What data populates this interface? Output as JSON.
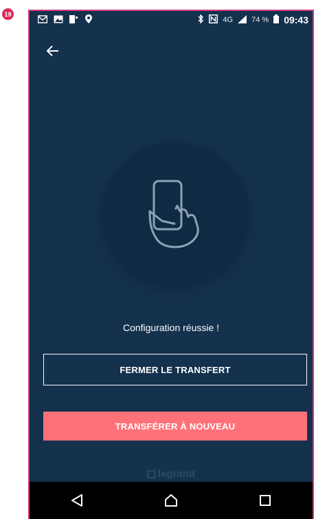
{
  "step_badge": "19",
  "status_bar": {
    "left_icons": [
      "mail-icon",
      "image-icon",
      "notification-icon",
      "location-icon"
    ],
    "right_icons": [
      "bluetooth-icon",
      "nfc-icon",
      "signal-icon"
    ],
    "network": "4G",
    "battery": "74 %",
    "time": "09:43"
  },
  "header": {
    "back_icon": "arrow-left-icon"
  },
  "hero": {
    "icon": "hand-holding-phone-icon"
  },
  "message": "Configuration réussie !",
  "buttons": {
    "close_transfer": "FERMER LE TRANSFERT",
    "transfer_again": "TRANSFÉRER À NOUVEAU"
  },
  "brand": "legrand",
  "nav": {
    "icons": [
      "back-triangle-icon",
      "home-icon",
      "recents-square-icon"
    ]
  },
  "colors": {
    "background": "#14314d",
    "accent": "#ff7178",
    "badge": "#e02a5a"
  }
}
